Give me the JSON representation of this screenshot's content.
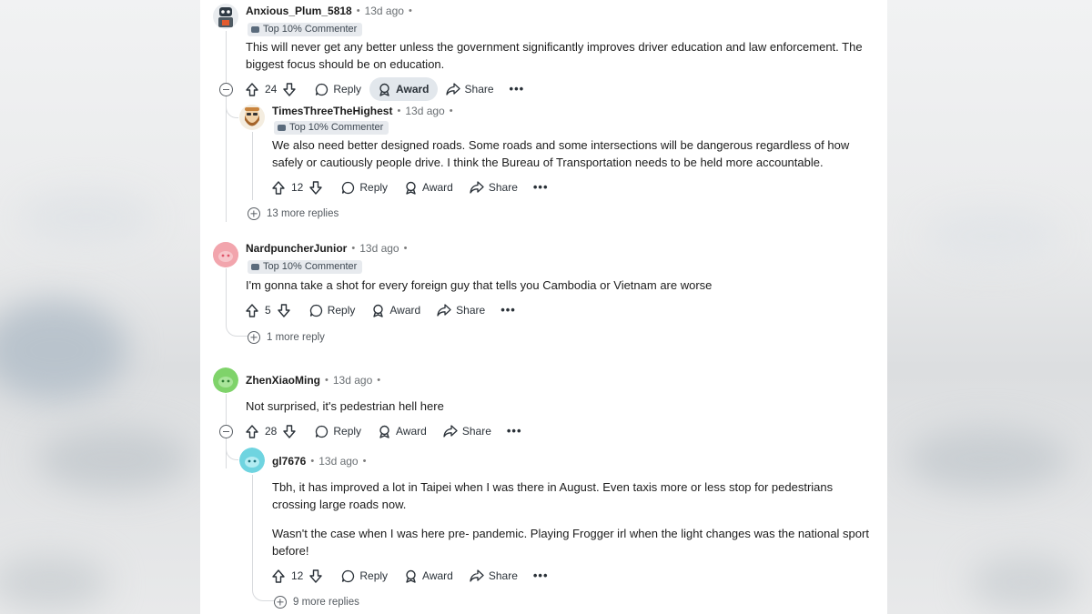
{
  "comments": [
    {
      "username": "Anxious_Plum_5818",
      "time": "13d ago",
      "flair": "Top 10% Commenter",
      "body": "This will never get any better unless the government significantly improves driver education and law enforcement. The biggest focus should be on education.",
      "votes": "24",
      "reply_label": "Reply",
      "award_label": "Award",
      "share_label": "Share",
      "more_label": "•••",
      "avatar_color": "#9aa3ab",
      "replies": [
        {
          "username": "TimesThreeTheHighest",
          "time": "13d ago",
          "flair": "Top 10% Commenter",
          "body": "We also need better designed roads. Some roads and some intersections will be dangerous regardless of how safely or cautiously people drive. I think the Bureau of Transportation needs to be held more accountable.",
          "votes": "12",
          "reply_label": "Reply",
          "award_label": "Award",
          "share_label": "Share",
          "more_label": "•••",
          "avatar_color": "#d8c7a8"
        }
      ],
      "more_replies": "13 more replies"
    },
    {
      "username": "NardpuncherJunior",
      "time": "13d ago",
      "flair": "Top 10% Commenter",
      "body": "I'm gonna take a shot for every foreign guy that tells you Cambodia or Vietnam are worse",
      "votes": "5",
      "reply_label": "Reply",
      "award_label": "Award",
      "share_label": "Share",
      "more_label": "•••",
      "avatar_color": "#f2a5ad",
      "more_replies": "1 more reply"
    },
    {
      "username": "ZhenXiaoMing",
      "time": "13d ago",
      "body": "Not surprised, it's pedestrian hell here",
      "votes": "28",
      "reply_label": "Reply",
      "award_label": "Award",
      "share_label": "Share",
      "more_label": "•••",
      "avatar_color": "#7fd36a",
      "replies": [
        {
          "username": "gl7676",
          "time": "13d ago",
          "body_p1": "Tbh, it has improved a lot in Taipei when I was there in August. Even taxis more or less stop for pedestrians crossing large roads now.",
          "body_p2": "Wasn't the case when I was here pre- pandemic. Playing Frogger irl when the light changes was the national sport before!",
          "votes": "12",
          "reply_label": "Reply",
          "award_label": "Award",
          "share_label": "Share",
          "more_label": "•••",
          "avatar_color": "#6fd4e0"
        }
      ],
      "more_replies": "9 more replies"
    }
  ],
  "colors": {
    "award_highlight": "#e2e7ec",
    "thread_line": "#d8dadd"
  }
}
